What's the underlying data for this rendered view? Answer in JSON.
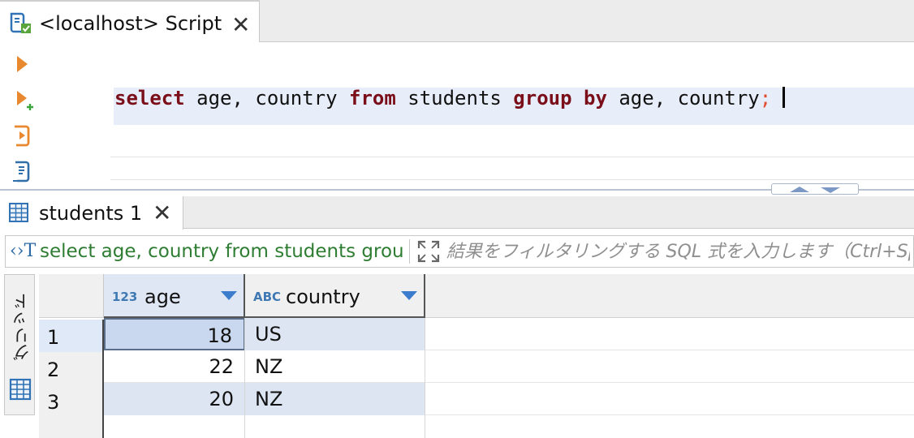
{
  "editor_tab": {
    "title": "<localhost> Script",
    "close": "✕"
  },
  "editor": {
    "tokens": [
      {
        "text": "select",
        "type": "keyword"
      },
      {
        "text": " age, country ",
        "type": "text"
      },
      {
        "text": "from",
        "type": "keyword"
      },
      {
        "text": " students ",
        "type": "text"
      },
      {
        "text": "group",
        "type": "keyword"
      },
      {
        "text": " ",
        "type": "text"
      },
      {
        "text": "by",
        "type": "keyword"
      },
      {
        "text": " age, country",
        "type": "text"
      },
      {
        "text": ";",
        "type": "punct"
      }
    ]
  },
  "gutter": {
    "buttons": [
      "execute-statement-icon",
      "execute-in-new-tab-icon",
      "execute-script-icon",
      "explain-plan-icon"
    ]
  },
  "results_tab": {
    "title": "students 1",
    "close": "✕"
  },
  "filter": {
    "icon_text": "‹›T",
    "query_text": "select age, country from students group by age, country",
    "placeholder": "結果をフィルタリングする SQL 式を入力します（Ctrl+Space）"
  },
  "side_panel": {
    "label": "グリッド"
  },
  "grid": {
    "columns": [
      {
        "type": "123",
        "name": "age"
      },
      {
        "type": "ABC",
        "name": "country"
      }
    ],
    "rows": [
      {
        "num": "1",
        "age": "18",
        "country": "US"
      },
      {
        "num": "2",
        "age": "22",
        "country": "NZ"
      },
      {
        "num": "3",
        "age": "20",
        "country": "NZ"
      }
    ]
  },
  "colors": {
    "keyword": "#7a0f1a",
    "semicolon": "#e14b2e",
    "filter_query": "#2e7d32",
    "accent": "#3b7dcc"
  }
}
